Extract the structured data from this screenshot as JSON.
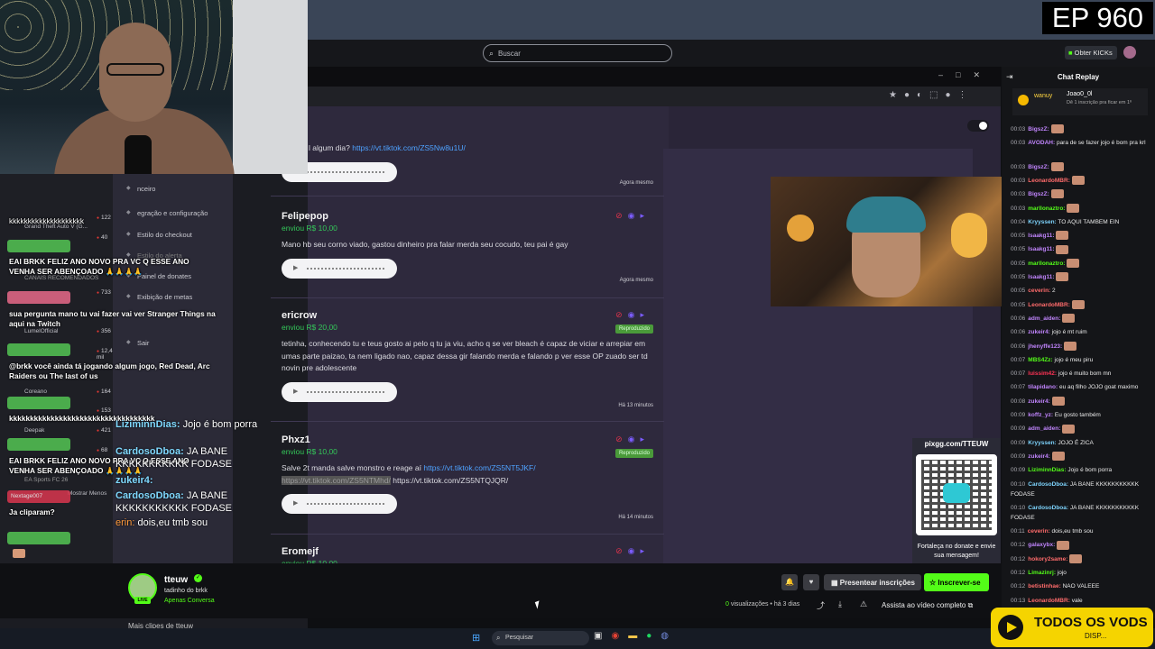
{
  "episode": "EP 960",
  "search": {
    "placeholder": "Buscar"
  },
  "header": {
    "obter_label": "Obter KICKs"
  },
  "donations": [
    {
      "name": "",
      "amount": "",
      "message": "l algum dia?",
      "link": "https://vt.tiktok.com/ZS5Nw8u1U/",
      "time": "Agora mesmo"
    },
    {
      "name": "Felipepop",
      "amount": "enviou R$ 10,00",
      "message": "Mano hb seu corno viado, gastou dinheiro pra falar merda seu cocudo, teu pai é gay",
      "time": "Agora mesmo"
    },
    {
      "name": "ericrow",
      "amount": "enviou R$ 20,00",
      "status": "Reproduzido",
      "message": "tetinha, conhecendo tu e teus gosto ai pelo q tu ja viu, acho q se ver bleach é capaz de viciar e arrepiar em umas parte paizao, ta nem ligado nao, capaz dessa gir falando merda e falando p ver esse OP zuado ser td novin pre adolescente",
      "time": "Há 13 minutos"
    },
    {
      "name": "Phxz1",
      "amount": "enviou R$ 10,00",
      "status": "Reproduzido",
      "message": "Salve 2t manda salve monstro e reage aí",
      "link": "https://vt.tiktok.com/ZS5NT5JKF/",
      "link2_hl": "https://vt.tiktok.com/ZS5NTMhd/",
      "link3": "https://vt.tiktok.com/ZS5NTQJQR/",
      "time": "Há 14 minutos"
    },
    {
      "name": "Eromejf",
      "amount": "enviou R$ 10,00"
    }
  ],
  "qr": {
    "title": "pixgg.com/TTEUW",
    "caption": "Fortaleça no donate e envie sua mensagem!"
  },
  "sidebar": {
    "menu": [
      "nceiro",
      "egração e configuração",
      "Estilo do checkout",
      "Estilo do alerta",
      "Painel de donates",
      "Exibição de metas",
      "Sair"
    ],
    "channels": [
      {
        "name": "Grand Theft Auto V (G...",
        "count": "122"
      },
      {
        "name": "",
        "count": "40"
      },
      {
        "name": "",
        "count": "733"
      },
      {
        "name": "LumelOfficial",
        "count": "356"
      },
      {
        "name": "",
        "count": "12,4 mil"
      },
      {
        "name": "Coreano",
        "count": "164"
      },
      {
        "name": "",
        "count": "153"
      },
      {
        "name": "Deepak",
        "count": "421"
      },
      {
        "name": "",
        "count": "68"
      }
    ],
    "recommended_label": "CANAIS RECOMENDADOS",
    "show_less": "Mostrar Menos",
    "sports": "EA Sports FC 26"
  },
  "overlay_chat": [
    {
      "text": "kkkkkkkkkkkkkkkkkkkk"
    },
    {
      "text": "EAI BRKK FELIZ ANO NOVO PRA VC Q ESSE ANO VENHA SER ABENÇOADO 🙏🙏🙏🙏"
    },
    {
      "text": "sua pergunta mano tu vai fazer vai ver Stranger Things na aqui na Twitch"
    },
    {
      "text": "@brkk você ainda tá jogando algum jogo, Red Dead, Arc Raiders ou The last of us"
    },
    {
      "text": "kkkkkkkkkkkkkkkkkkkkkkkkkkkkkkkkkkk"
    },
    {
      "text": "EAI BRKK FELIZ ANO NOVO PRA VC Q ESSE ANO VENHA SER ABENÇOADO 🙏🙏🙏🙏"
    },
    {
      "user": "Nextage007",
      "text": "Ja cliparam?"
    }
  ],
  "overlay_big": [
    {
      "user": "LiziminnDias:",
      "text": "Jojo é bom porra"
    },
    {
      "user": "CardosoDboa:",
      "text": "JA BANE KKKKKKKKKKK FODASE"
    },
    {
      "user": "zukeir4:",
      "text": ""
    },
    {
      "user": "CardosoDboa:",
      "text": "JA BANE KKKKKKKKKKK FODASE"
    },
    {
      "user": "erin:",
      "text": "dois,eu tmb sou"
    }
  ],
  "chat_replay": {
    "title": "Chat Replay",
    "pinned": {
      "user": "wanuy",
      "target": "Joao0_0l",
      "note": "Dê 1 inscrição pra ficar em 1º"
    },
    "messages": [
      {
        "t": "00:03",
        "u": "BigszZ:",
        "c": "#c084fc",
        "m": "",
        "emote": true
      },
      {
        "t": "00:03",
        "u": "AVODAH:",
        "c": "#c084fc",
        "m": "para de se fazer jojo é bom pra krl"
      },
      {
        "t": "00:03",
        "u": "BigszZ:",
        "c": "#c084fc",
        "m": "",
        "emote": true
      },
      {
        "t": "00:03",
        "u": "LeonardoMBR:",
        "c": "#ff6b6b",
        "m": "",
        "emote": true
      },
      {
        "t": "00:03",
        "u": "BigszZ:",
        "c": "#c084fc",
        "m": "",
        "emote": true
      },
      {
        "t": "00:03",
        "u": "marllonaztro:",
        "c": "#53fc18",
        "m": "",
        "emote": true
      },
      {
        "t": "00:04",
        "u": "Kryyssen:",
        "c": "#7dd3fc",
        "m": "TO AQUI TAMBEM EIN"
      },
      {
        "t": "00:05",
        "u": "Isaakg11:",
        "c": "#c084fc",
        "m": "",
        "emote": true
      },
      {
        "t": "00:05",
        "u": "Isaakg11:",
        "c": "#c084fc",
        "m": "",
        "emote": true
      },
      {
        "t": "00:05",
        "u": "marllonaztro:",
        "c": "#53fc18",
        "m": "",
        "emote": true
      },
      {
        "t": "00:05",
        "u": "Isaakg11:",
        "c": "#c084fc",
        "m": "",
        "emote": true
      },
      {
        "t": "00:05",
        "u": "ceverin:",
        "c": "#ff6b6b",
        "m": "2"
      },
      {
        "t": "00:05",
        "u": "LeonardoMBR:",
        "c": "#ff6b6b",
        "m": "",
        "emote": true
      },
      {
        "t": "00:06",
        "u": "adm_aiden:",
        "c": "#c084fc",
        "m": "",
        "emote": true
      },
      {
        "t": "00:06",
        "u": "zukeir4:",
        "c": "#c084fc",
        "m": "jojo é mt ruim"
      },
      {
        "t": "00:06",
        "u": "jhenyffe123:",
        "c": "#c084fc",
        "m": "",
        "emote": true
      },
      {
        "t": "00:07",
        "u": "MBS4Zz:",
        "c": "#53fc18",
        "m": "jojo é meu piru"
      },
      {
        "t": "00:07",
        "u": "luissim42:",
        "c": "#ff3355",
        "m": "jojo é muito bom mn"
      },
      {
        "t": "00:07",
        "u": "tilapidano:",
        "c": "#c084fc",
        "m": "eu aq filho JOJO goat maximo"
      },
      {
        "t": "00:08",
        "u": "zukeir4:",
        "c": "#c084fc",
        "m": "",
        "emote": true
      },
      {
        "t": "00:09",
        "u": "koffz_yz:",
        "c": "#c084fc",
        "m": "Eu gosto também"
      },
      {
        "t": "00:09",
        "u": "adm_aiden:",
        "c": "#c084fc",
        "m": "",
        "emote": true
      },
      {
        "t": "00:09",
        "u": "Kryyssen:",
        "c": "#7dd3fc",
        "m": "JOJO É ZICA"
      },
      {
        "t": "00:09",
        "u": "zukeir4:",
        "c": "#c084fc",
        "m": "",
        "emote": true
      },
      {
        "t": "00:09",
        "u": "LiziminnDias:",
        "c": "#53fc18",
        "m": "Jojo é bom porra"
      },
      {
        "t": "00:10",
        "u": "CardosoDboa:",
        "c": "#7dd3fc",
        "m": "JA BANE KKKKKKKKKKK FODASE"
      },
      {
        "t": "00:10",
        "u": "CardosoDboa:",
        "c": "#7dd3fc",
        "m": "JA BANE KKKKKKKKKKK FODASE"
      },
      {
        "t": "00:11",
        "u": "ceverin:",
        "c": "#ff6b6b",
        "m": "dois,eu tmb sou"
      },
      {
        "t": "00:12",
        "u": "galaxybx:",
        "c": "#c084fc",
        "m": "",
        "emote": true
      },
      {
        "t": "00:12",
        "u": "hokory2same:",
        "c": "#ff6b6b",
        "m": "",
        "emote": true
      },
      {
        "t": "00:12",
        "u": "Limazinrj:",
        "c": "#53fc18",
        "m": "jojo"
      },
      {
        "t": "00:12",
        "u": "betistinhae:",
        "c": "#ff6b6b",
        "m": "NAO VALEEE"
      },
      {
        "t": "00:13",
        "u": "LeonardoMBR:",
        "c": "#ff6b6b",
        "m": "vale"
      }
    ]
  },
  "video": {
    "channel": "tteuw",
    "subtitle": "tadinho do brkk",
    "category": "Apenas Conversa",
    "live_tag": "LIVE",
    "gift_label": "Presentear inscrições",
    "sub_label": "Inscrever-se",
    "views_count": "0",
    "views_text": "visualizações • há 3 dias",
    "watch_full": "Assista ao vídeo completo",
    "more_clips": "Mais clipes de tteuw"
  },
  "taskbar": {
    "search_placeholder": "Pesquisar"
  },
  "logo": {
    "text": "TODOS OS VODS",
    "sub": "DISP..."
  }
}
